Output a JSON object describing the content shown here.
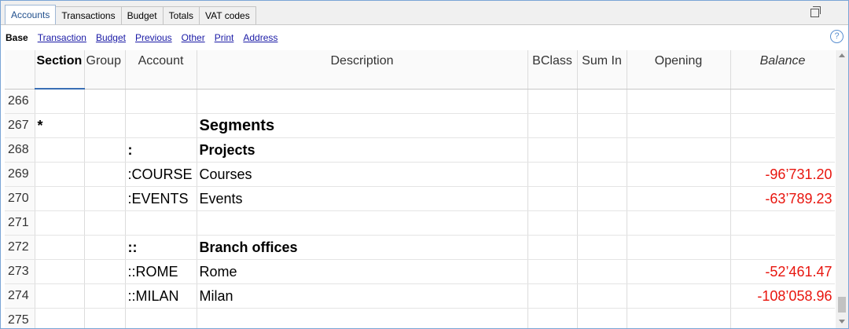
{
  "tabs": [
    "Accounts",
    "Transactions",
    "Budget",
    "Totals",
    "VAT codes"
  ],
  "views": [
    "Base",
    "Transaction",
    "Budget",
    "Previous",
    "Other",
    "Print",
    "Address"
  ],
  "help": "?",
  "columns": [
    "Section",
    "Group",
    "Account",
    "Description",
    "BClass",
    "Sum In",
    "Opening",
    "Balance"
  ],
  "rows": [
    {
      "num": "266",
      "section": "",
      "group": "",
      "account": "",
      "description": "",
      "bclass": "",
      "sumin": "",
      "opening": "",
      "balance": ""
    },
    {
      "num": "267",
      "section": "*",
      "group": "",
      "account": "",
      "description": "Segments",
      "bclass": "",
      "sumin": "",
      "opening": "",
      "balance": ""
    },
    {
      "num": "268",
      "section": "",
      "group": "",
      "account": ":",
      "description": "Projects",
      "bclass": "",
      "sumin": "",
      "opening": "",
      "balance": ""
    },
    {
      "num": "269",
      "section": "",
      "group": "",
      "account": ":COURSE",
      "description": "Courses",
      "bclass": "",
      "sumin": "",
      "opening": "",
      "balance": "-96’731.20"
    },
    {
      "num": "270",
      "section": "",
      "group": "",
      "account": ":EVENTS",
      "description": "Events",
      "bclass": "",
      "sumin": "",
      "opening": "",
      "balance": "-63’789.23"
    },
    {
      "num": "271",
      "section": "",
      "group": "",
      "account": "",
      "description": "",
      "bclass": "",
      "sumin": "",
      "opening": "",
      "balance": ""
    },
    {
      "num": "272",
      "section": "",
      "group": "",
      "account": "::",
      "description": "Branch offices",
      "bclass": "",
      "sumin": "",
      "opening": "",
      "balance": ""
    },
    {
      "num": "273",
      "section": "",
      "group": "",
      "account": "::ROME",
      "description": "Rome",
      "bclass": "",
      "sumin": "",
      "opening": "",
      "balance": "-52’461.47"
    },
    {
      "num": "274",
      "section": "",
      "group": "",
      "account": "::MILAN",
      "description": "Milan",
      "bclass": "",
      "sumin": "",
      "opening": "",
      "balance": "-108’058.96"
    },
    {
      "num": "275",
      "section": "",
      "group": "",
      "account": "",
      "description": "",
      "bclass": "",
      "sumin": "",
      "opening": "",
      "balance": ""
    }
  ],
  "colors": {
    "negative": "#e8150e",
    "link": "#1a1aa6",
    "active_tab": "#1f4e8c"
  }
}
